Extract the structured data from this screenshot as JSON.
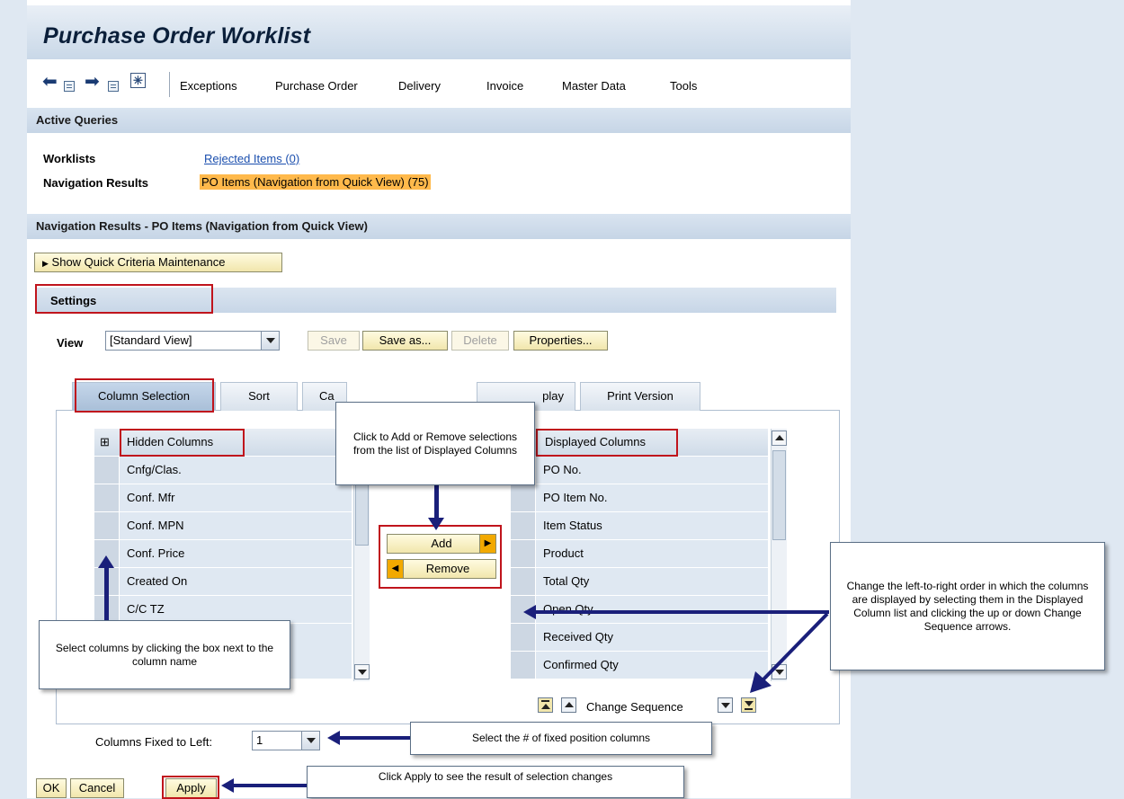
{
  "page": {
    "title": "Purchase Order Worklist",
    "menu": [
      "Exceptions",
      "Purchase Order",
      "Delivery",
      "Invoice",
      "Master Data",
      "Tools"
    ]
  },
  "active_queries": {
    "header": "Active Queries",
    "worklists_label": "Worklists",
    "worklists_link": "Rejected Items (0)",
    "nav_results_label": "Navigation Results",
    "nav_results_value": "PO Items (Navigation from Quick View) (75)"
  },
  "results": {
    "header": "Navigation Results - PO Items (Navigation from Quick View)",
    "quick_criteria_button": "Show Quick Criteria Maintenance"
  },
  "settings": {
    "header": "Settings",
    "view_label": "View",
    "view_value": "[Standard View]",
    "buttons": {
      "save": "Save",
      "save_as": "Save as...",
      "delete": "Delete",
      "properties": "Properties..."
    }
  },
  "tabs": {
    "column_selection": "Column Selection",
    "sort": "Sort",
    "calculation_partial": "Ca",
    "display_partial": "play",
    "print_version": "Print Version"
  },
  "hidden_columns": {
    "header": "Hidden Columns",
    "items": [
      "Cnfg/Clas.",
      "Conf. Mfr",
      "Conf. MPN",
      "Conf. Price",
      "Created On",
      "C/C TZ"
    ]
  },
  "transfer": {
    "add": "Add",
    "remove": "Remove"
  },
  "displayed_columns": {
    "header": "Displayed Columns",
    "items": [
      "PO No.",
      "PO Item No.",
      "Item Status",
      "Product",
      "Total Qty",
      "Open Qty",
      "Received Qty",
      "Confirmed Qty"
    ]
  },
  "sequence": {
    "label": "Change Sequence"
  },
  "fixed": {
    "label": "Columns Fixed to Left:",
    "value": "1"
  },
  "footer_buttons": {
    "ok": "OK",
    "cancel": "Cancel",
    "apply": "Apply"
  },
  "callouts": {
    "add_remove": "Click to Add or Remove selections from the list of Displayed Columns",
    "select_columns": "Select columns by clicking the box next to the column name",
    "change_order": "Change the left-to-right order in which the columns are displayed by selecting them in the Displayed Column list and clicking the up or down Change Sequence arrows.",
    "fixed_columns": "Select the # of fixed position columns",
    "apply": "Click Apply to see the result of selection changes"
  },
  "colors": {
    "accent_orange": "#ffb94b",
    "annotation_red": "#c0141c",
    "arrow_navy": "#1a1f7a"
  }
}
